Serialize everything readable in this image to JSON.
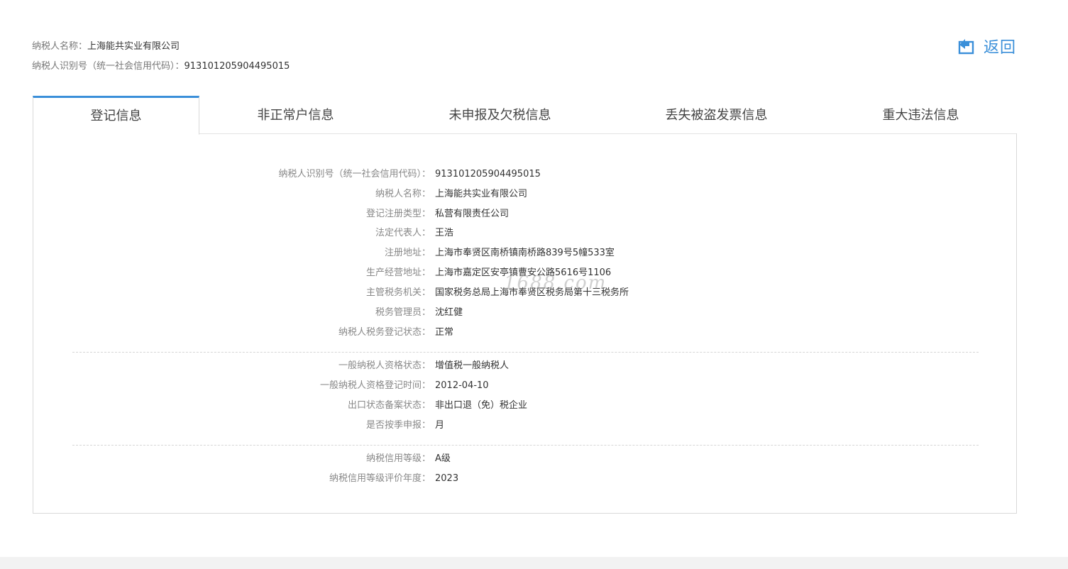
{
  "header": {
    "name_label": "纳税人名称：",
    "name_value": "上海能共实业有限公司",
    "id_label": "纳税人识别号（统一社会信用代码）：",
    "id_value": "913101205904495015",
    "back_label": "返回",
    "back_icon": "back-arrow-icon"
  },
  "tabs": [
    {
      "label": "登记信息",
      "active": true
    },
    {
      "label": "非正常户信息",
      "active": false
    },
    {
      "label": "未申报及欠税信息",
      "active": false
    },
    {
      "label": "丢失被盗发票信息",
      "active": false
    },
    {
      "label": "重大违法信息",
      "active": false
    }
  ],
  "section1": [
    {
      "label": "纳税人识别号（统一社会信用代码）：",
      "value": "913101205904495015"
    },
    {
      "label": "纳税人名称：",
      "value": "上海能共实业有限公司"
    },
    {
      "label": "登记注册类型：",
      "value": "私营有限责任公司"
    },
    {
      "label": "法定代表人：",
      "value": "王浩"
    },
    {
      "label": "注册地址：",
      "value": "上海市奉贤区南桥镇南桥路839号5幢533室"
    },
    {
      "label": "生产经营地址：",
      "value": "上海市嘉定区安亭镇曹安公路5616号1106"
    },
    {
      "label": "主管税务机关：",
      "value": "国家税务总局上海市奉贤区税务局第十三税务所"
    },
    {
      "label": "税务管理员：",
      "value": "沈红健"
    },
    {
      "label": "纳税人税务登记状态：",
      "value": "正常"
    }
  ],
  "section2": [
    {
      "label": "一般纳税人资格状态：",
      "value": "增值税一般纳税人"
    },
    {
      "label": "一般纳税人资格登记时间：",
      "value": "2012-04-10"
    },
    {
      "label": "出口状态备案状态：",
      "value": "非出口退（免）税企业"
    },
    {
      "label": "是否按季申报：",
      "value": "月"
    }
  ],
  "section3": [
    {
      "label": "纳税信用等级：",
      "value": "A级"
    },
    {
      "label": "纳税信用等级评价年度：",
      "value": "2023"
    }
  ],
  "watermark": "1688.com",
  "colors": {
    "accent": "#3a8fd9",
    "label": "#888888",
    "value": "#333333"
  }
}
